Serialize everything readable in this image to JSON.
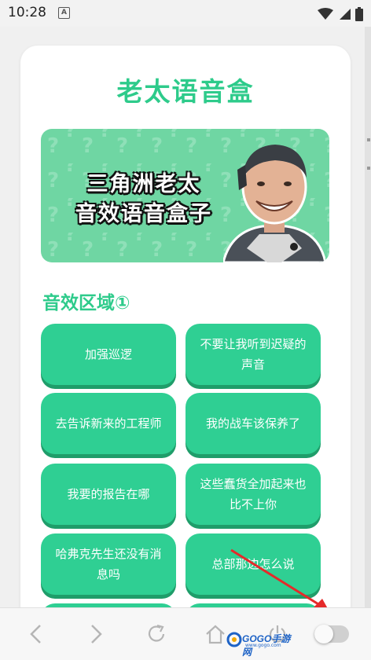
{
  "status_bar": {
    "time": "10:28",
    "notification_letter": "A"
  },
  "app": {
    "title": "老太语音盒"
  },
  "banner": {
    "line1": "三角洲老太",
    "line2": "音效语音盒子"
  },
  "section": {
    "title": "音效区域①"
  },
  "sounds": [
    "加强巡逻",
    "不要让我听到迟疑的声音",
    "去告诉新来的工程师",
    "我的战车该保养了",
    "我要的报告在哪",
    "这些蠢货全加起来也比不上你",
    "哈弗克先生还没有消息吗",
    "总部那边怎么说"
  ],
  "watermark": {
    "brand": "GOGO手游网",
    "url": "www.gogo.com"
  },
  "colors": {
    "accent": "#2ecb8b",
    "button": "#2fcf93",
    "button_shadow": "#1f9d6a",
    "banner_bg": "#6fd6a3"
  }
}
